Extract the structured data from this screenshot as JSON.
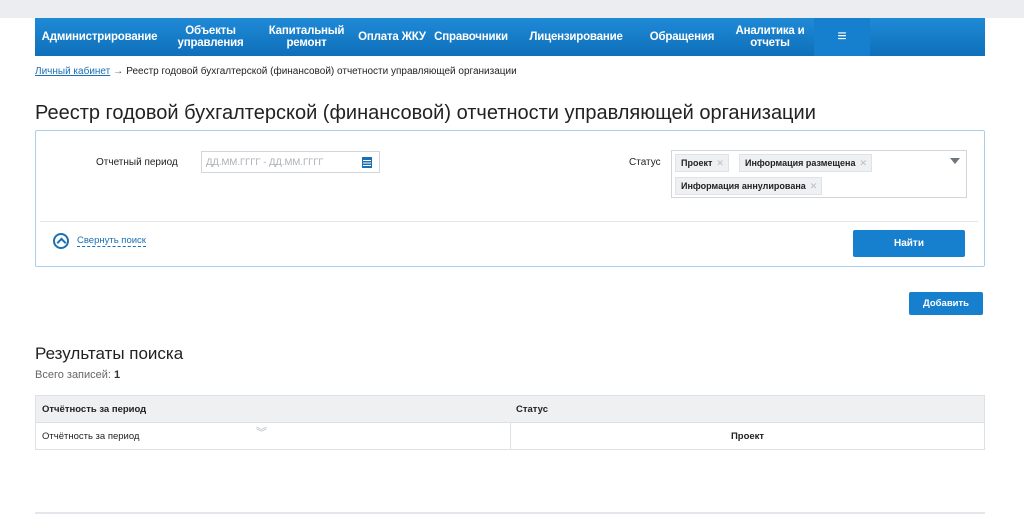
{
  "nav": {
    "items": [
      {
        "label": "Администрирование",
        "width": 129
      },
      {
        "label": "Объекты\nуправления",
        "width": 93
      },
      {
        "label": "Капитальный\nремонт",
        "width": 99
      },
      {
        "label": "Оплата ЖКУ",
        "width": 72
      },
      {
        "label": "Справочники",
        "width": 86
      },
      {
        "label": "Лицензирование",
        "width": 124
      },
      {
        "label": "Обращения",
        "width": 88
      },
      {
        "label": "Аналитика и\nотчеты",
        "width": 88
      }
    ],
    "menu_icon": "hamburger-icon"
  },
  "breadcrumb": {
    "home": "Личный кабинет",
    "separator": "→",
    "current": "Реестр годовой бухгалтерской (финансовой) отчетности управляющей организации"
  },
  "page_title": "Реестр годовой бухгалтерской (финансовой) отчетности управляющей организации",
  "filters": {
    "period_label": "Отчетный период",
    "period_placeholder": "ДД.ММ.ГГГГ - ДД.ММ.ГГГГ",
    "status_label": "Статус",
    "status_tags": [
      "Проект",
      "Информация размещена",
      "Информация аннулирована"
    ],
    "collapse_label": "Свернуть поиск",
    "find_label": "Найти"
  },
  "add_label": "Добавить",
  "results": {
    "title": "Результаты поиска",
    "count_label": "Всего записей:",
    "count": "1",
    "columns": [
      "Отчётность за период",
      "Статус"
    ],
    "rows": [
      {
        "period": "Отчётность за период",
        "status": "Проект"
      }
    ]
  },
  "colors": {
    "accent": "#1680cf",
    "link": "#1a6fb5",
    "border": "#a9cdec"
  }
}
